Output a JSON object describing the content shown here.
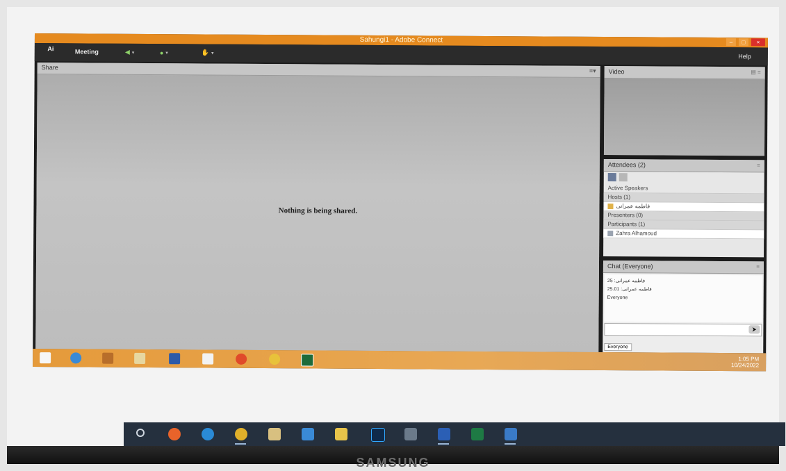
{
  "window": {
    "title": "Sahungi1 - Adobe Connect"
  },
  "menubar": {
    "logo": "Ai",
    "meeting_label": "Meeting",
    "help_label": "Help"
  },
  "share_pod": {
    "title": "Share",
    "message": "Nothing is being shared."
  },
  "video_pod": {
    "title": "Video"
  },
  "attendees_pod": {
    "title": "Attendees (2)",
    "active_speakers": "Active Speakers",
    "hosts_header": "Hosts (1)",
    "host_name": "فاطمه عمرانی",
    "presenters_header": "Presenters (0)",
    "participants_header": "Participants (1)",
    "participant_name": "Zahra Alhamoud"
  },
  "chat_pod": {
    "title": "Chat (Everyone)",
    "messages": [
      "فاطمه عمرانی: 25",
      "فاطمه عمرانی: 25.01",
      "Everyone"
    ],
    "tab_label": "Everyone"
  },
  "inner_taskbar": {
    "time": "1:05 PM",
    "date": "10/24/2022"
  },
  "host_taskbar": {
    "icons": [
      "search-icon",
      "firefox-icon",
      "edge-icon",
      "chrome-icon",
      "store-icon",
      "mail-icon",
      "folder-icon",
      "photoshop-icon",
      "calculator-icon",
      "word-icon",
      "excel-icon",
      "photos-icon"
    ]
  },
  "bezel": {
    "brand": "SAMSUNG"
  },
  "colors": {
    "title_orange": "#e58a1f",
    "taskbar_dark": "#25303e"
  }
}
